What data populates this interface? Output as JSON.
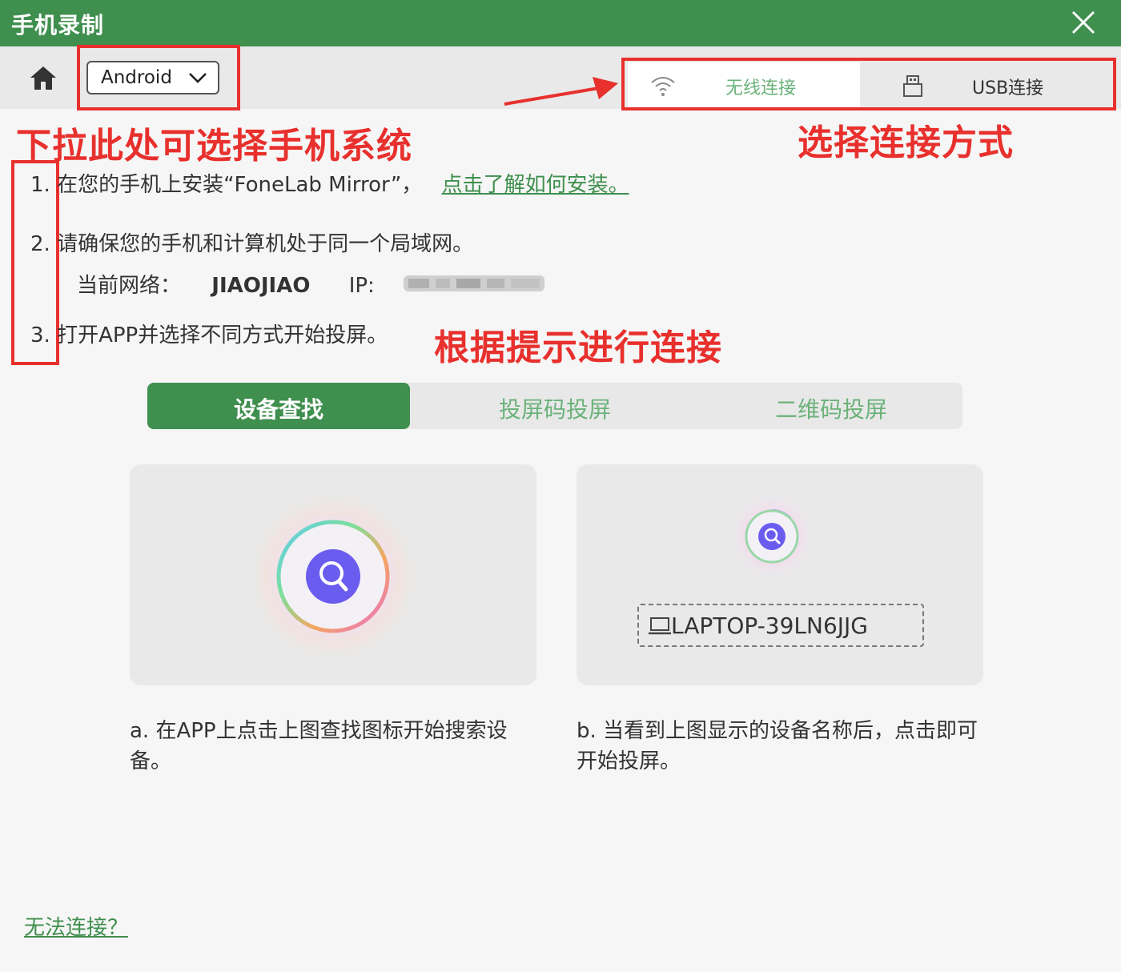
{
  "window": {
    "title": "手机录制"
  },
  "toolbar": {
    "os_selected": "Android",
    "connection_tabs": [
      {
        "label": "无线连接",
        "icon": "wifi-icon",
        "active": true
      },
      {
        "label": "USB连接",
        "icon": "usb-icon",
        "active": false
      }
    ]
  },
  "annotations": {
    "os_hint": "下拉此处可选择手机系统",
    "conn_hint": "选择连接方式",
    "steps_hint": "根据提示进行连接"
  },
  "steps": {
    "step1_num": "1.",
    "step1_text": "在您的手机上安装“FoneLab Mirror”，",
    "step1_link": "点击了解如何安装。",
    "step2_num": "2.",
    "step2_text": "请确保您的手机和计算机处于同一个局域网。",
    "network_label": "当前网络：",
    "network_name": "JIAOJIAO",
    "ip_label": "IP:",
    "step3_num": "3.",
    "step3_text": "打开APP并选择不同方式开始投屏。"
  },
  "mode_tabs": [
    {
      "label": "设备查找",
      "active": true
    },
    {
      "label": "投屏码投屏",
      "active": false
    },
    {
      "label": "二维码投屏",
      "active": false
    }
  ],
  "cards": {
    "device_name": "LAPTOP-39LN6JJG",
    "caption_a": "a. 在APP上点击上图查找图标开始搜索设备。",
    "caption_b": "b. 当看到上图显示的设备名称后，点击即可开始投屏。"
  },
  "footer": {
    "help_link": "无法连接？"
  },
  "colors": {
    "brand_green": "#3f8f4e",
    "light_green": "#6ab27a",
    "annotation_red": "#e8302d",
    "search_purple": "#6b5cf0"
  }
}
